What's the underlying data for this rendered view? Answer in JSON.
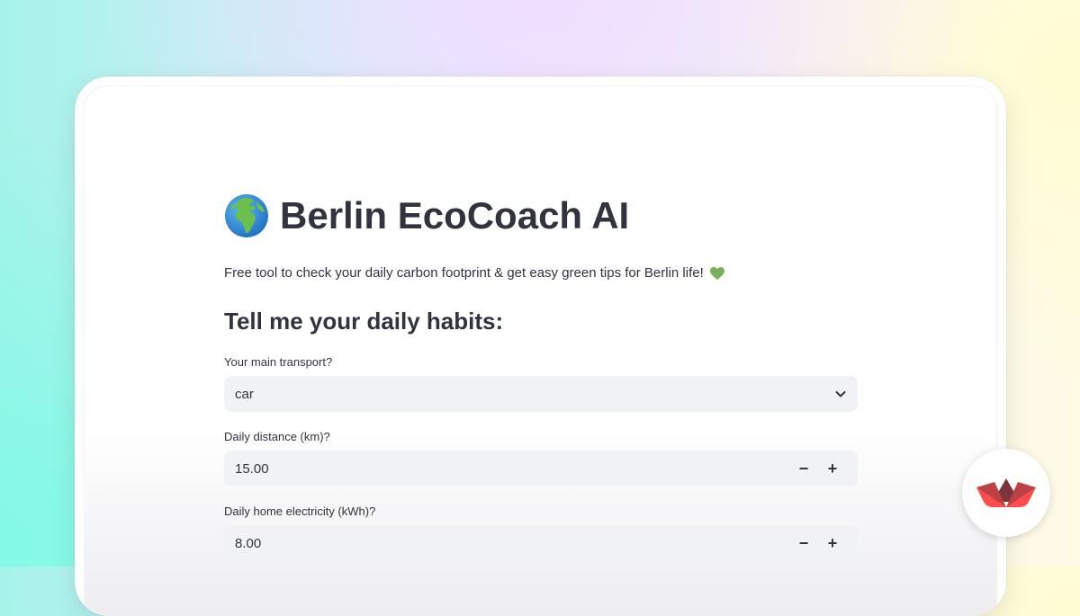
{
  "app": {
    "title": "Berlin EcoCoach AI",
    "subtitle": "Free tool to check your daily carbon footprint & get easy green tips for Berlin life!",
    "title_icon": "globe-europe-africa-icon",
    "subtitle_icon": "green-heart-icon"
  },
  "form": {
    "heading": "Tell me your daily habits:",
    "transport": {
      "label": "Your main transport?",
      "value": "car"
    },
    "distance": {
      "label": "Daily distance (km)?",
      "value": "15.00",
      "minus": "−",
      "plus": "+"
    },
    "electricity": {
      "label": "Daily home electricity (kWh)?",
      "value": "8.00",
      "minus": "−",
      "plus": "+"
    }
  },
  "badge": {
    "icon": "streamlit-logo-icon"
  },
  "colors": {
    "text": "#31333f",
    "field_bg": "#f0f2f6",
    "accent_red": "#ff4b4b"
  }
}
